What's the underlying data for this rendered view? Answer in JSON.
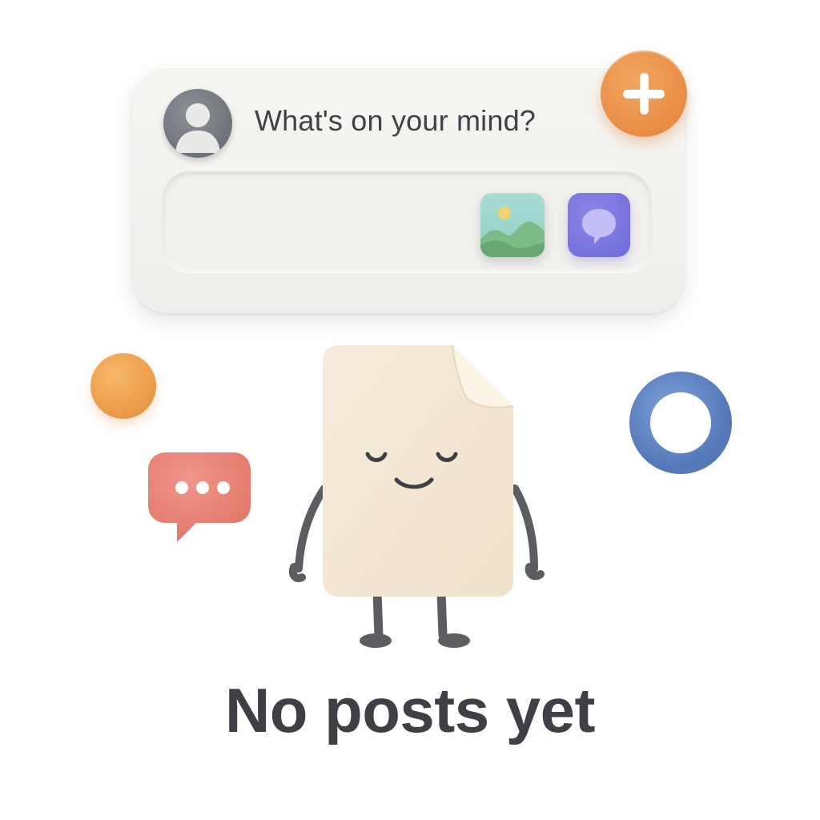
{
  "composer": {
    "prompt": "What's on your mind?",
    "icons": {
      "avatar": "user-avatar-icon",
      "add": "plus-icon",
      "photo": "image-icon",
      "chat": "chat-bubble-icon"
    }
  },
  "empty_state": {
    "title": "No posts yet"
  },
  "colors": {
    "accent_orange": "#e98d45",
    "chat_purple": "#756fdb",
    "ring_blue": "#5b84c4",
    "speech_coral": "#e57e6e",
    "text_dark": "#3e4045"
  }
}
